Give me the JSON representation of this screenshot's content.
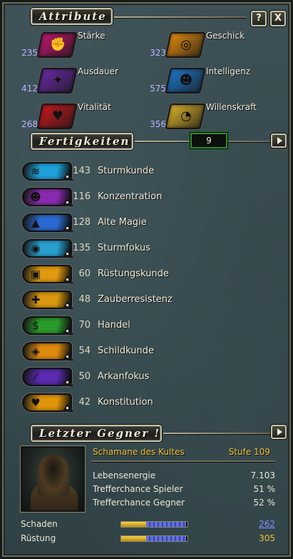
{
  "header": {
    "title": "Attribute",
    "help_label": "?",
    "close_label": "X"
  },
  "attributes": [
    {
      "name": "Stärke",
      "value": "235",
      "color": "#c0166e",
      "icon": "fist-icon",
      "glyph": "✊"
    },
    {
      "name": "Geschick",
      "value": "323",
      "color": "#e08a10",
      "icon": "target-icon",
      "glyph": "◎"
    },
    {
      "name": "Ausdauer",
      "value": "412",
      "color": "#6a2aa8",
      "icon": "runner-icon",
      "glyph": "✦"
    },
    {
      "name": "Intelligenz",
      "value": "575",
      "color": "#1e78c8",
      "icon": "head-icon",
      "glyph": "☻"
    },
    {
      "name": "Vitalität",
      "value": "268",
      "color": "#c8181e",
      "icon": "heart-icon",
      "glyph": "♥"
    },
    {
      "name": "Willenskraft",
      "value": "356",
      "color": "#d8b02a",
      "icon": "mask-icon",
      "glyph": "◔"
    }
  ],
  "skills_section": {
    "title": "Fertigkeiten",
    "points": "9"
  },
  "skills": [
    {
      "name": "Sturmkunde",
      "value": "143",
      "color": "#1fa0d8",
      "icon": "storm-icon",
      "glyph": "≋"
    },
    {
      "name": "Konzentration",
      "value": "116",
      "color": "#8a2ab0",
      "icon": "mind-icon",
      "glyph": "☻"
    },
    {
      "name": "Alte Magie",
      "value": "128",
      "color": "#2a6ad0",
      "icon": "wizard-hat-icon",
      "glyph": "▲"
    },
    {
      "name": "Sturmfokus",
      "value": "135",
      "color": "#2aa0d0",
      "icon": "storm-eye-icon",
      "glyph": "◉"
    },
    {
      "name": "Rüstungskunde",
      "value": "60",
      "color": "#e09a10",
      "icon": "armor-icon",
      "glyph": "▣"
    },
    {
      "name": "Zauberresistenz",
      "value": "48",
      "color": "#d89810",
      "icon": "resist-icon",
      "glyph": "✚"
    },
    {
      "name": "Handel",
      "value": "70",
      "color": "#2a9a2a",
      "icon": "trade-icon",
      "glyph": "$"
    },
    {
      "name": "Schildkunde",
      "value": "54",
      "color": "#e08a10",
      "icon": "shield-icon",
      "glyph": "◈"
    },
    {
      "name": "Arkanfokus",
      "value": "50",
      "color": "#5a2ab0",
      "icon": "wand-icon",
      "glyph": "⁄"
    },
    {
      "name": "Konstitution",
      "value": "42",
      "color": "#e0960a",
      "icon": "pulse-icon",
      "glyph": "♥"
    }
  ],
  "enemy_section": {
    "title": "Letzter Gegner !",
    "name": "Schamane des Kultes",
    "level": "Stufe 109",
    "stats": [
      {
        "label": "Lebensenergie",
        "value": "7.103"
      },
      {
        "label": "Trefferchance Spieler",
        "value": "51 %"
      },
      {
        "label": "Trefferchance Gegner",
        "value": "52 %"
      }
    ],
    "bars": [
      {
        "label": "Schaden",
        "value": "262",
        "value_color": "#8a8aff",
        "gold_fraction": 0.38,
        "blue_fraction": 0.6
      },
      {
        "label": "Rüstung",
        "value": "305",
        "value_color": "#f0c030",
        "gold_fraction": 0.38,
        "blue_fraction": 0.6
      }
    ]
  }
}
